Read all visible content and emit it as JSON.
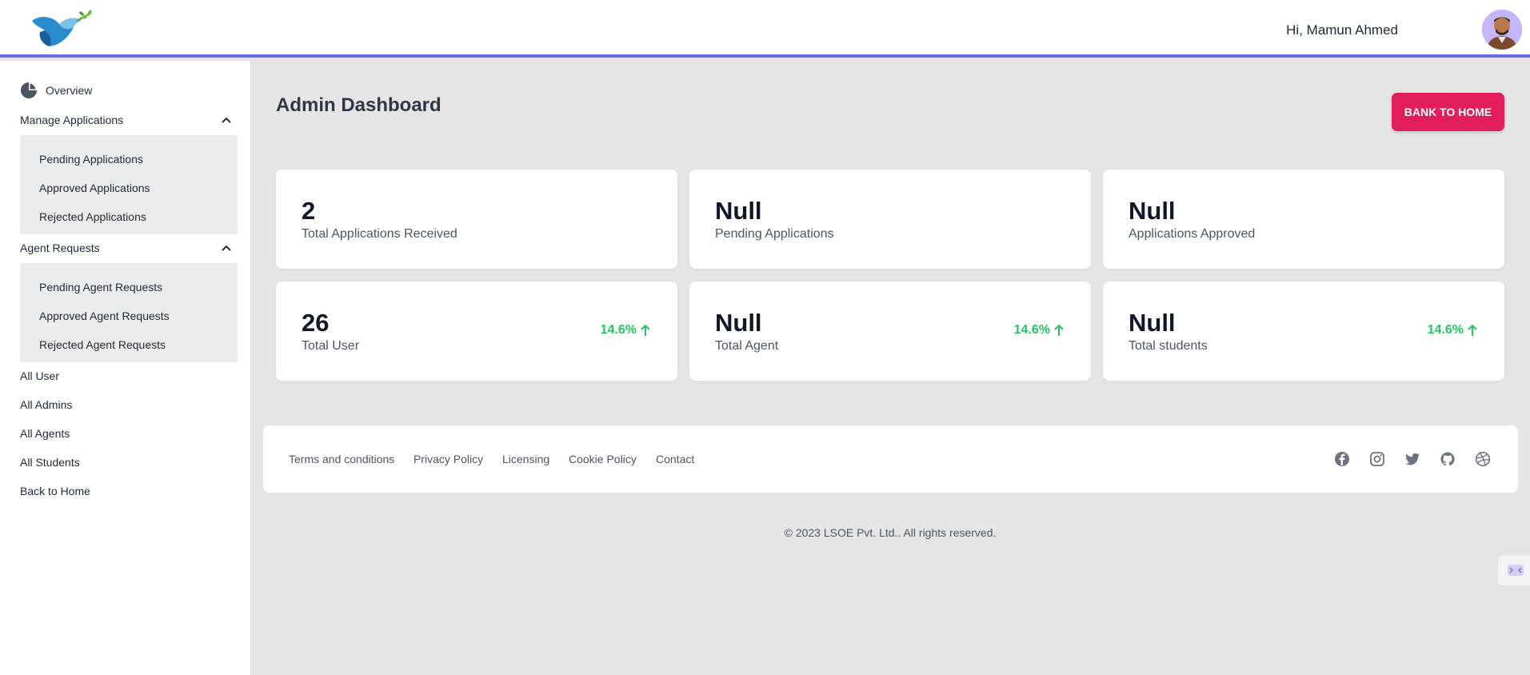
{
  "header": {
    "greeting": "Hi, Mamun Ahmed"
  },
  "sidebar": {
    "overview": "Overview",
    "manage_applications": {
      "label": "Manage Applications",
      "items": [
        "Pending Applications",
        "Approved Applications",
        "Rejected Applications"
      ]
    },
    "agent_requests": {
      "label": "Agent Requests",
      "items": [
        "Pending Agent Requests",
        "Approved Agent Requests",
        "Rejected Agent Requests"
      ]
    },
    "links": [
      "All User",
      "All Admins",
      "All Agents",
      "All Students",
      "Back to Home"
    ]
  },
  "main": {
    "title": "Admin Dashboard",
    "home_button": "BANK TO HOME",
    "cards": [
      {
        "value": "2",
        "label": "Total Applications Received"
      },
      {
        "value": "Null",
        "label": "Pending Applications"
      },
      {
        "value": "Null",
        "label": "Applications Approved"
      },
      {
        "value": "26",
        "label": "Total User",
        "trend": "14.6%"
      },
      {
        "value": "Null",
        "label": "Total Agent",
        "trend": "14.6%"
      },
      {
        "value": "Null",
        "label": "Total students",
        "trend": "14.6%"
      }
    ]
  },
  "footer": {
    "links": [
      "Terms and conditions",
      "Privacy Policy",
      "Licensing",
      "Cookie Policy",
      "Contact"
    ],
    "social_icons": [
      "facebook-icon",
      "instagram-icon",
      "twitter-icon",
      "github-icon",
      "dribbble-icon"
    ],
    "copyright": "© 2023 LSOE Pvt. Ltd.. All rights reserved."
  },
  "colors": {
    "accent": "#6d6ae8",
    "button": "#e11d5c",
    "trend": "#22c55e"
  }
}
